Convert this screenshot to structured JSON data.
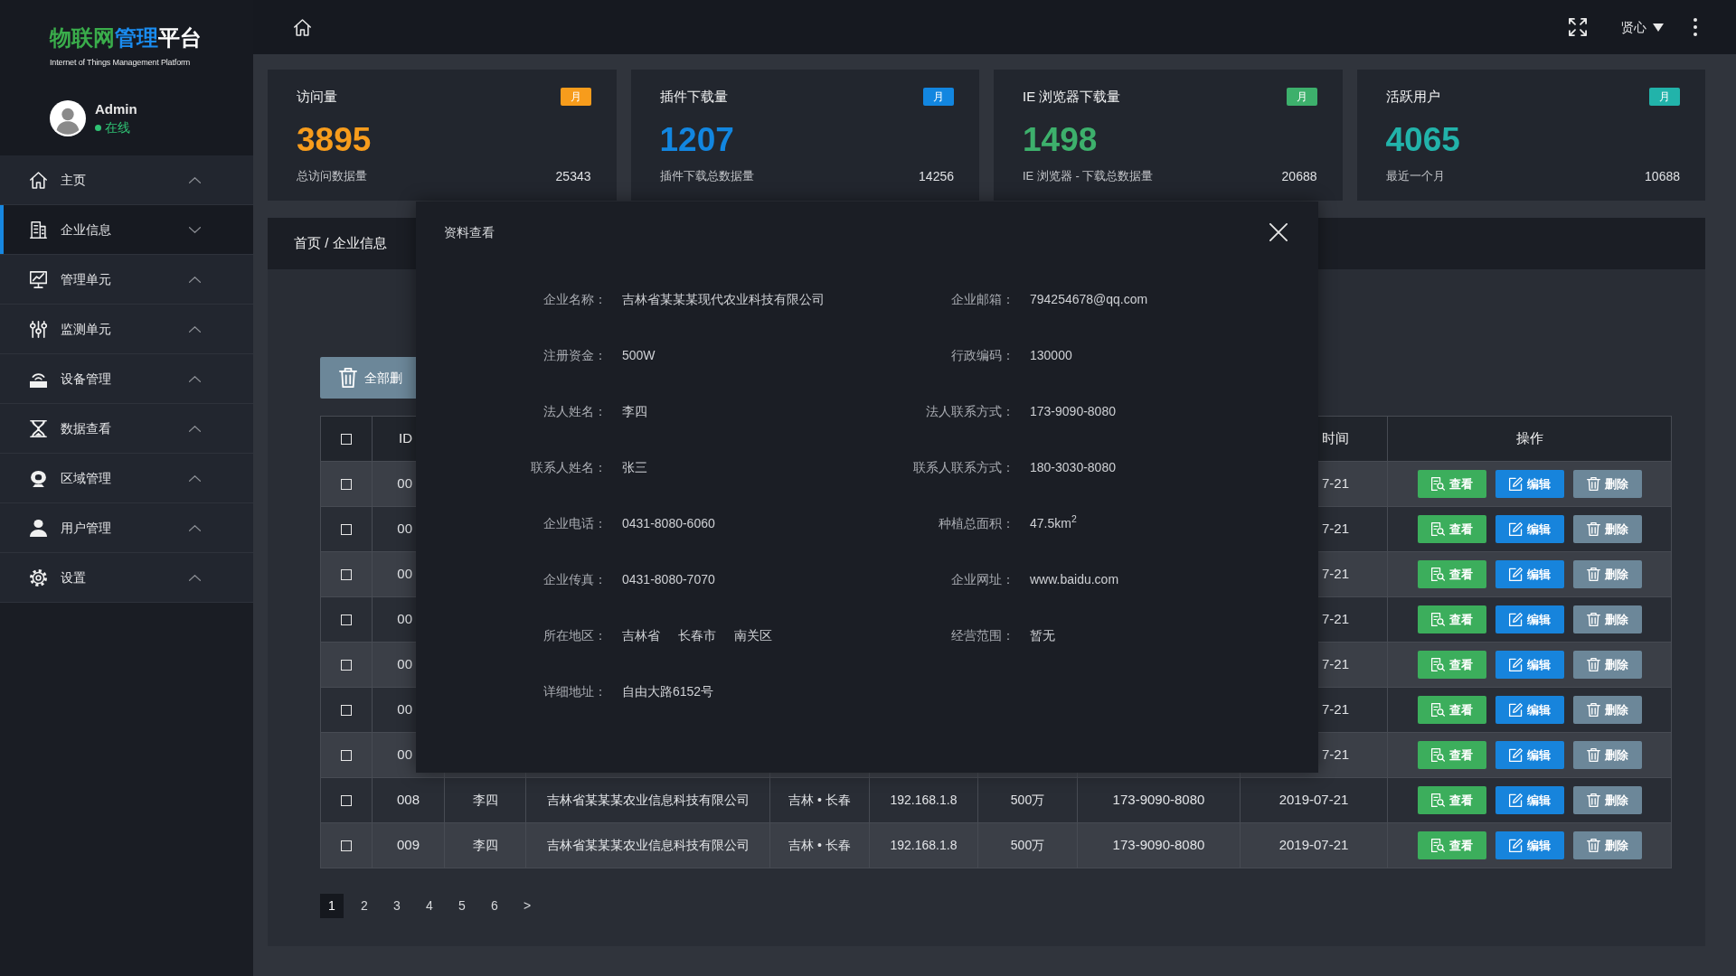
{
  "sidebar": {
    "logo": {
      "parts": [
        "物联网",
        "管理",
        "平台"
      ],
      "subtitle": "Internet of Things Management Platform"
    },
    "user": {
      "name": "Admin",
      "status": "在线",
      "online": true
    },
    "menu": [
      {
        "label": "主页",
        "selected": false,
        "expanded": false
      },
      {
        "label": "企业信息",
        "selected": true,
        "expanded": true
      },
      {
        "label": "管理单元",
        "selected": false,
        "expanded": false
      },
      {
        "label": "监测单元",
        "selected": false,
        "expanded": false
      },
      {
        "label": "设备管理",
        "selected": false,
        "expanded": false
      },
      {
        "label": "数据查看",
        "selected": false,
        "expanded": false
      },
      {
        "label": "区域管理",
        "selected": false,
        "expanded": false
      },
      {
        "label": "用户管理",
        "selected": false,
        "expanded": false
      },
      {
        "label": "设置",
        "selected": false,
        "expanded": false
      }
    ]
  },
  "top_bar": {
    "user": "贤心"
  },
  "stat_cards": [
    {
      "title": "访问量",
      "badge": "月",
      "color": "#f79c1c",
      "value": "3895",
      "caption": "总访问数据量",
      "total": "25343"
    },
    {
      "title": "插件下载量",
      "badge": "月",
      "color": "#1286e0",
      "value": "1207",
      "caption": "插件下载总数据量",
      "total": "14256"
    },
    {
      "title": "IE 浏览器下载量",
      "badge": "月",
      "color": "#3db06c",
      "value": "1498",
      "caption": "IE 浏览器 - 下载总数据量",
      "total": "20688"
    },
    {
      "title": "活跃用户",
      "badge": "月",
      "color": "#22b3aa",
      "value": "4065",
      "caption": "最近一个月",
      "total": "10688"
    }
  ],
  "breadcrumb": "首页 / 企业信息",
  "toolbar": {
    "delete_all": "全部删"
  },
  "table": {
    "header": {
      "checked": false,
      "id": "ID",
      "time": "时间",
      "actions": "操作"
    },
    "rows": [
      {
        "checked": false,
        "id": "00",
        "time": "7-21",
        "actions": [
          {
            "kind": "view",
            "label": "查看"
          },
          {
            "kind": "edit",
            "label": "编辑"
          },
          {
            "kind": "delete",
            "label": "删除"
          }
        ]
      },
      {
        "checked": false,
        "id": "00",
        "time": "7-21",
        "actions": [
          {
            "kind": "view",
            "label": "查看"
          },
          {
            "kind": "edit",
            "label": "编辑"
          },
          {
            "kind": "delete",
            "label": "删除"
          }
        ]
      },
      {
        "checked": false,
        "id": "00",
        "time": "7-21",
        "actions": [
          {
            "kind": "view",
            "label": "查看"
          },
          {
            "kind": "edit",
            "label": "编辑"
          },
          {
            "kind": "delete",
            "label": "删除"
          }
        ]
      },
      {
        "checked": false,
        "id": "00",
        "time": "7-21",
        "actions": [
          {
            "kind": "view",
            "label": "查看"
          },
          {
            "kind": "edit",
            "label": "编辑"
          },
          {
            "kind": "delete",
            "label": "删除"
          }
        ]
      },
      {
        "checked": false,
        "id": "00",
        "time": "7-21",
        "actions": [
          {
            "kind": "view",
            "label": "查看"
          },
          {
            "kind": "edit",
            "label": "编辑"
          },
          {
            "kind": "delete",
            "label": "删除"
          }
        ]
      },
      {
        "checked": false,
        "id": "00",
        "time": "7-21",
        "actions": [
          {
            "kind": "view",
            "label": "查看"
          },
          {
            "kind": "edit",
            "label": "编辑"
          },
          {
            "kind": "delete",
            "label": "删除"
          }
        ]
      },
      {
        "checked": false,
        "id": "00",
        "time": "7-21",
        "actions": [
          {
            "kind": "view",
            "label": "查看"
          },
          {
            "kind": "edit",
            "label": "编辑"
          },
          {
            "kind": "delete",
            "label": "删除"
          }
        ]
      },
      {
        "checked": false,
        "id": "008",
        "column_3": "李四",
        "column_4": "吉林省某某某农业信息科技有限公司",
        "column_5": "吉林 • 长春",
        "column_6": "192.168.1.8",
        "column_7": "500万",
        "column_8": "173-9090-8080",
        "time": "2019-07-21",
        "actions": [
          {
            "kind": "view",
            "label": "查看"
          },
          {
            "kind": "edit",
            "label": "编辑"
          },
          {
            "kind": "delete",
            "label": "删除"
          }
        ]
      },
      {
        "checked": false,
        "id": "009",
        "column_3": "李四",
        "column_4": "吉林省某某某农业信息科技有限公司",
        "column_5": "吉林 • 长春",
        "column_6": "192.168.1.8",
        "column_7": "500万",
        "column_8": "173-9090-8080",
        "time": "2019-07-21",
        "actions": [
          {
            "kind": "view",
            "label": "查看"
          },
          {
            "kind": "edit",
            "label": "编辑"
          },
          {
            "kind": "delete",
            "label": "删除"
          }
        ]
      }
    ]
  },
  "pagination": {
    "pages": [
      {
        "label": "1",
        "selected": true
      },
      {
        "label": "2",
        "selected": false
      },
      {
        "label": "3",
        "selected": false
      },
      {
        "label": "4",
        "selected": false
      },
      {
        "label": "5",
        "selected": false
      },
      {
        "label": "6",
        "selected": false
      }
    ],
    "next": ">"
  },
  "modal": {
    "title": "资料查看",
    "rows": [
      [
        {
          "kind": "text",
          "label": "企业名称：",
          "value": "吉林省某某某现代农业科技有限公司"
        },
        {
          "kind": "text",
          "label": "企业邮箱：",
          "value": "794254678@qq.com"
        }
      ],
      [
        {
          "kind": "text",
          "label": "注册资金：",
          "value": "500W"
        },
        {
          "kind": "text",
          "label": "行政编码：",
          "value": "130000"
        }
      ],
      [
        {
          "kind": "text",
          "label": "法人姓名：",
          "value": "李四"
        },
        {
          "kind": "text",
          "label": "法人联系方式：",
          "value": "173-9090-8080"
        }
      ],
      [
        {
          "kind": "text",
          "label": "联系人姓名：",
          "value": "张三"
        },
        {
          "kind": "text",
          "label": "联系人联系方式：",
          "value": "180-3030-8080"
        }
      ],
      [
        {
          "kind": "text",
          "label": "企业电话：",
          "value": "0431-8080-6060"
        },
        {
          "kind": "text",
          "label": "种植总面积：",
          "value": "47.5km$^{2}$"
        }
      ],
      [
        {
          "kind": "text",
          "label": "企业传真：",
          "value": "0431-8080-7070"
        },
        {
          "kind": "text",
          "label": "企业网址：",
          "value": "www.baidu.com"
        }
      ],
      [
        {
          "kind": "parts",
          "label": "所在地区：",
          "parts": [
            "吉林省",
            "长春市",
            "南关区"
          ]
        },
        {
          "kind": "text",
          "label": "经营范围：",
          "value": "暂无"
        }
      ],
      [
        {
          "kind": "text",
          "label": "详细地址：",
          "value": "自由大路6152号"
        }
      ]
    ]
  }
}
